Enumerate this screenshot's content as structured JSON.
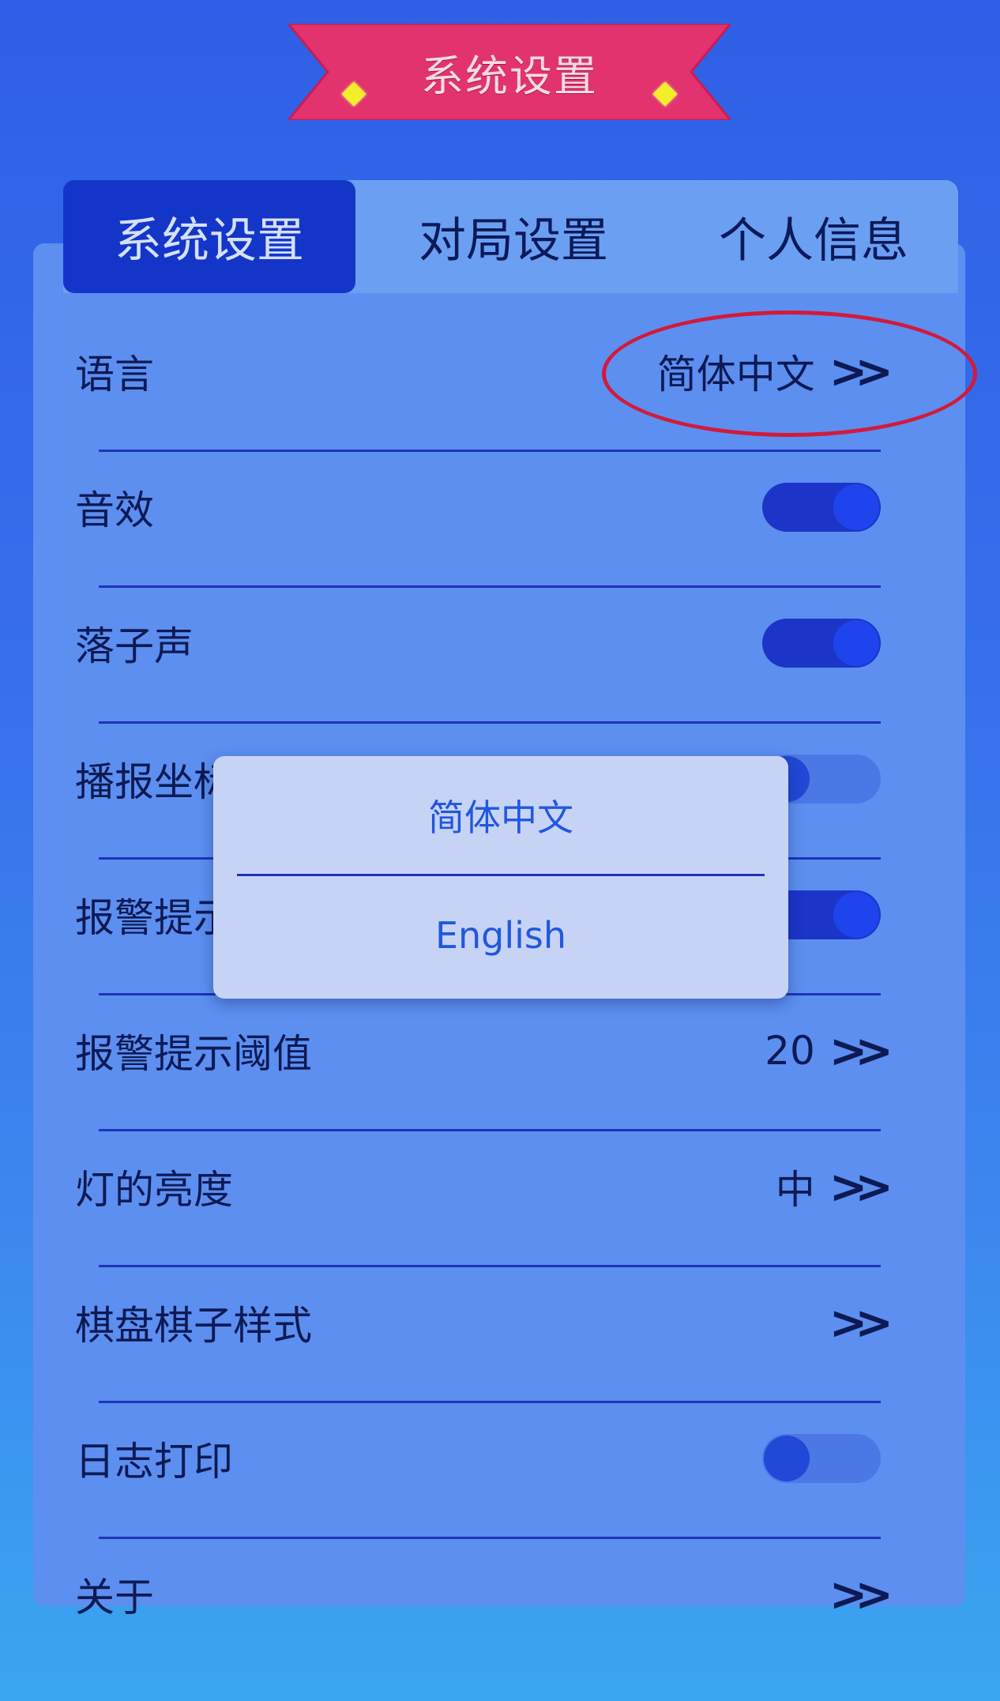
{
  "header": {
    "title": "系统设置"
  },
  "tabs": [
    {
      "label": "系统设置",
      "active": true
    },
    {
      "label": "对局设置",
      "active": false
    },
    {
      "label": "个人信息",
      "active": false
    }
  ],
  "settings": [
    {
      "label": "语言",
      "value": "简体中文",
      "control": "chevron"
    },
    {
      "label": "音效",
      "control": "toggle",
      "state": "on"
    },
    {
      "label": "落子声",
      "control": "toggle",
      "state": "on"
    },
    {
      "label": "播报坐标",
      "control": "toggle",
      "state": "off"
    },
    {
      "label": "报警提示",
      "control": "toggle",
      "state": "on"
    },
    {
      "label": "报警提示阈值",
      "value": "20",
      "control": "chevron"
    },
    {
      "label": "灯的亮度",
      "value": "中",
      "control": "chevron"
    },
    {
      "label": "棋盘棋子样式",
      "value": "",
      "control": "chevron"
    },
    {
      "label": "日志打印",
      "control": "toggle",
      "state": "off"
    },
    {
      "label": "关于",
      "value": "",
      "control": "chevron"
    }
  ],
  "language_popup": {
    "options": [
      "简体中文",
      "English"
    ]
  },
  "icons": {
    "chevron": "double-chevron-right-icon"
  },
  "colors": {
    "ribbon": "#e2336f",
    "active_tab": "#1436c8",
    "popup_text": "#2157e0",
    "annotation": "#d21a3b"
  }
}
